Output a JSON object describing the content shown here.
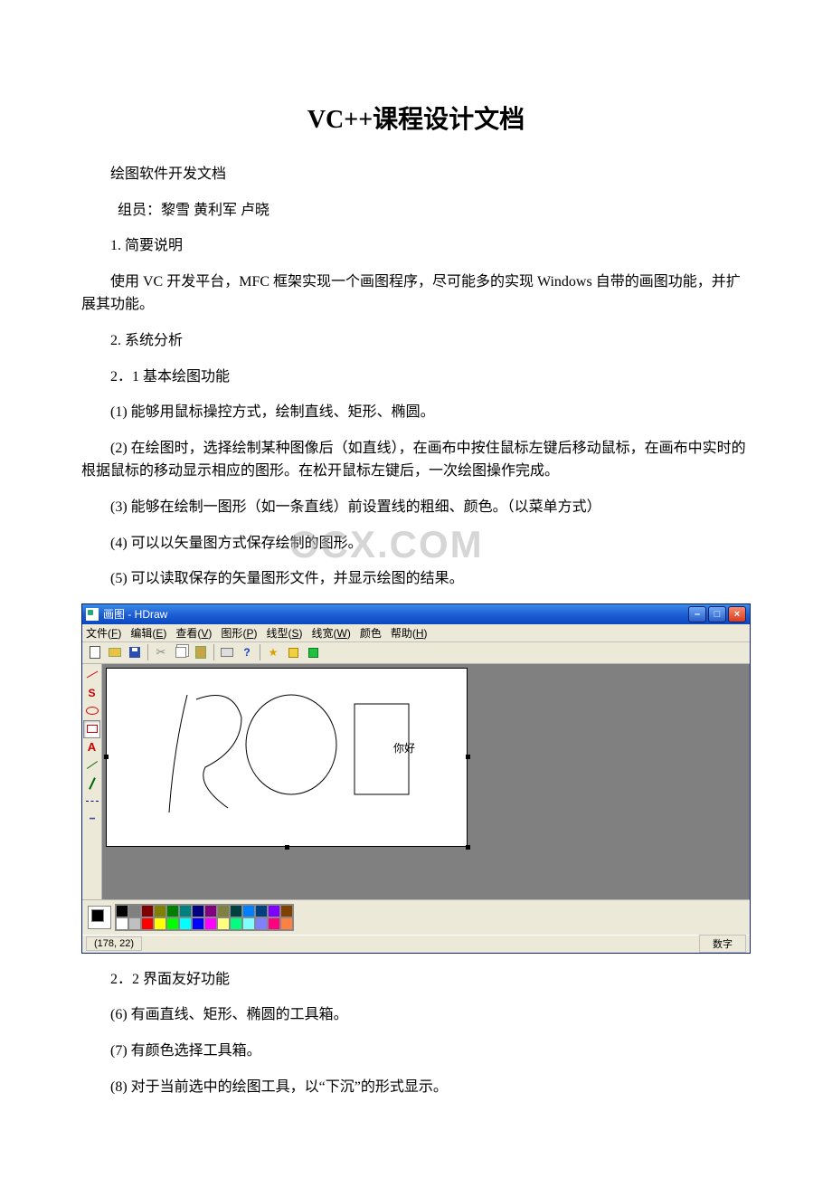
{
  "title": "VC++课程设计文档",
  "paragraphs": {
    "p1": "绘图软件开发文档",
    "p2": " 组员：黎雪 黄利军 卢晓",
    "p3": "1. 简要说明",
    "p4": "使用 VC 开发平台，MFC 框架实现一个画图程序，尽可能多的实现 Windows 自带的画图功能，并扩展其功能。",
    "p5": "2. 系统分析",
    "p6": "2．1 基本绘图功能",
    "p7": "(1) 能够用鼠标操控方式，绘制直线、矩形、椭圆。",
    "p8": "(2) 在绘图时，选择绘制某种图像后（如直线），在画布中按住鼠标左键后移动鼠标，在画布中实时的根据鼠标的移动显示相应的图形。在松开鼠标左键后，一次绘图操作完成。",
    "p9": "(3) 能够在绘制一图形（如一条直线）前设置线的粗细、颜色。（以菜单方式）",
    "p10": "(4) 可以以矢量图方式保存绘制的图形。",
    "p11": "(5) 可以读取保存的矢量图形文件，并显示绘图的结果。",
    "p12": "2．2 界面友好功能",
    "p13": " (6) 有画直线、矩形、椭圆的工具箱。",
    "p14": "(7) 有颜色选择工具箱。",
    "p15": "(8) 对于当前选中的绘图工具，以“下沉”的形式显示。"
  },
  "watermark": "OCX.COM",
  "app": {
    "title": "画图 - HDraw",
    "win_buttons": {
      "min": "–",
      "max": "□",
      "close": "×"
    },
    "menus": {
      "file": {
        "label": "文件",
        "key": "F"
      },
      "edit": {
        "label": "编辑",
        "key": "E"
      },
      "view": {
        "label": "查看",
        "key": "V"
      },
      "shape": {
        "label": "图形",
        "key": "P"
      },
      "ltype": {
        "label": "线型",
        "key": "S"
      },
      "lwidth": {
        "label": "线宽",
        "key": "W"
      },
      "color": {
        "label": "颜色",
        "key": ""
      },
      "help": {
        "label": "帮助",
        "key": "H"
      }
    },
    "toolbar_icons": {
      "new": "new-icon",
      "open": "open-icon",
      "save": "save-icon",
      "cut": "✂",
      "copy": "copy-icon",
      "paste": "paste-icon",
      "print": "print-icon",
      "help": "?",
      "star": "★"
    },
    "side_tools": {
      "line": "line-tool",
      "curve": "S",
      "ellipse": "ellipse-tool",
      "rect": "rect-tool",
      "text": "A",
      "diag": "diag-tool",
      "pen": "pen-tool",
      "dash": "—",
      "dots": "┅"
    },
    "canvas_text": "你好",
    "palette_colors_row1": [
      "#000000",
      "#808080",
      "#800000",
      "#808000",
      "#008000",
      "#008080",
      "#000080",
      "#800080",
      "#808040",
      "#004040",
      "#0080ff",
      "#004080",
      "#8000ff",
      "#804000"
    ],
    "palette_colors_row2": [
      "#ffffff",
      "#c0c0c0",
      "#ff0000",
      "#ffff00",
      "#00ff00",
      "#00ffff",
      "#0000ff",
      "#ff00ff",
      "#ffff80",
      "#00ff80",
      "#80ffff",
      "#8080ff",
      "#ff0080",
      "#ff8040"
    ],
    "status": {
      "coords": "(178, 22)",
      "right": "数字"
    }
  }
}
